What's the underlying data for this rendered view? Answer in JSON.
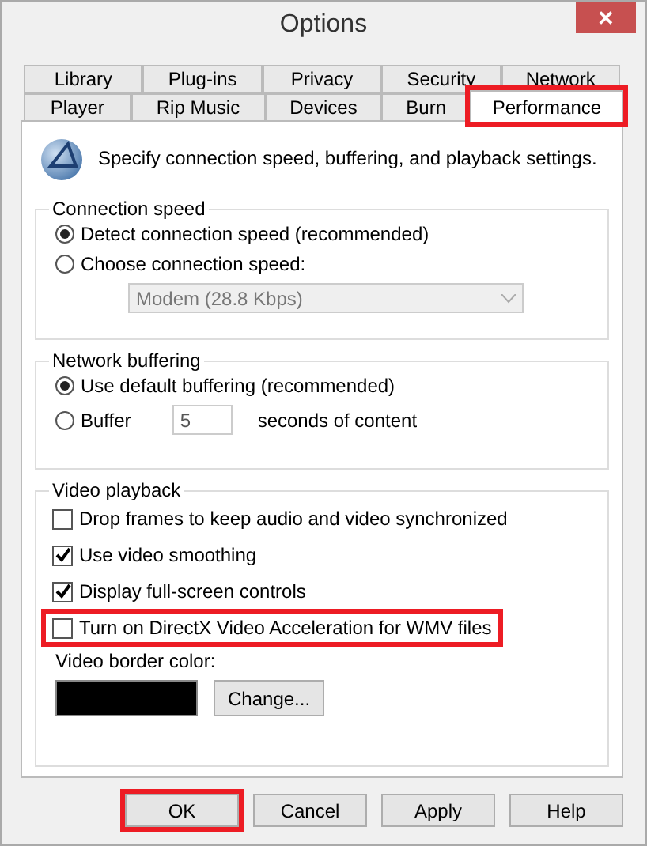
{
  "window": {
    "title": "Options",
    "close_glyph": "✕"
  },
  "tab_rows": [
    [
      {
        "label": "Library",
        "selected": false,
        "highlighted": false
      },
      {
        "label": "Plug-ins",
        "selected": false,
        "highlighted": false
      },
      {
        "label": "Privacy",
        "selected": false,
        "highlighted": false
      },
      {
        "label": "Security",
        "selected": false,
        "highlighted": false
      },
      {
        "label": "Network",
        "selected": false,
        "highlighted": false
      }
    ],
    [
      {
        "label": "Player",
        "selected": false,
        "highlighted": false
      },
      {
        "label": "Rip Music",
        "selected": false,
        "highlighted": false
      },
      {
        "label": "Devices",
        "selected": false,
        "highlighted": false
      },
      {
        "label": "Burn",
        "selected": false,
        "highlighted": false
      },
      {
        "label": "Performance",
        "selected": true,
        "highlighted": true
      }
    ]
  ],
  "intro": "Specify connection speed, buffering, and playback settings.",
  "connection_speed": {
    "title": "Connection speed",
    "options": [
      {
        "label": "Detect connection speed (recommended)",
        "selected": true
      },
      {
        "label": "Choose connection speed:",
        "selected": false
      }
    ],
    "speed_select": {
      "value": "Modem (28.8 Kbps)",
      "disabled": true
    }
  },
  "network_buffering": {
    "title": "Network buffering",
    "options": [
      {
        "label": "Use default buffering (recommended)",
        "selected": true
      },
      {
        "label": "Buffer",
        "selected": false
      }
    ],
    "buffer_value": "5",
    "buffer_suffix": "seconds of content"
  },
  "video_playback": {
    "title": "Video playback",
    "checkboxes": [
      {
        "label": "Drop frames to keep audio and video synchronized",
        "checked": false,
        "highlighted": false
      },
      {
        "label": "Use video smoothing",
        "checked": true,
        "highlighted": false
      },
      {
        "label": "Display full-screen controls",
        "checked": true,
        "highlighted": false
      },
      {
        "label": "Turn on DirectX Video Acceleration for WMV files",
        "checked": false,
        "highlighted": true
      }
    ],
    "border_color_label": "Video border color:",
    "change_button": "Change..."
  },
  "buttons": [
    {
      "label": "OK",
      "highlighted": true
    },
    {
      "label": "Cancel",
      "highlighted": false
    },
    {
      "label": "Apply",
      "highlighted": false
    },
    {
      "label": "Help",
      "highlighted": false
    }
  ]
}
